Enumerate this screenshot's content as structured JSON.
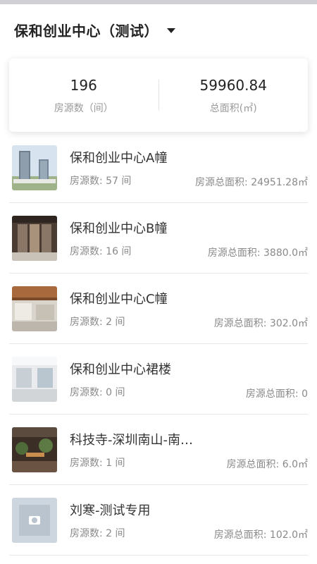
{
  "header": {
    "title": "保和创业中心（测试）",
    "dropdown_icon": "caret-down-icon"
  },
  "summary": {
    "rooms": {
      "value": "196",
      "label": "房源数（间）"
    },
    "area": {
      "value": "59960.84",
      "label": "总面积(㎡)"
    }
  },
  "buildings": [
    {
      "name": "保和创业中心A幢",
      "count": "房源数: 57 间",
      "area": "房源总面积: 24951.28㎡",
      "image": "tall-buildings-photo"
    },
    {
      "name": "保和创业中心B幢",
      "count": "房源数: 16 间",
      "area": "房源总面积: 3880.0㎡",
      "image": "elevator-lobby-photo"
    },
    {
      "name": "保和创业中心C幢",
      "count": "房源数: 2 间",
      "area": "房源总面积: 302.0㎡",
      "image": "office-lobby-photo"
    },
    {
      "name": "保和创业中心裙楼",
      "count": "房源数: 0 间",
      "area": "房源总面积: 0",
      "image": "empty-office-photo"
    },
    {
      "name": "科技寺-深圳南山-南山...",
      "count": "房源数: 1 间",
      "area": "房源总面积: 6.0㎡",
      "image": "cafe-interior-photo"
    },
    {
      "name": "刘寒-测试专用",
      "count": "房源数: 2 间",
      "area": "房源总面积: 102.0㎡",
      "image": "placeholder-camera-photo"
    }
  ]
}
